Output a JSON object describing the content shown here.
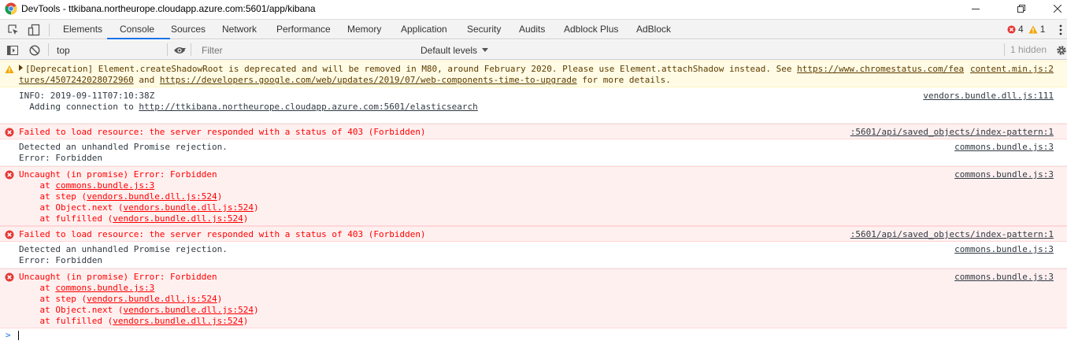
{
  "window": {
    "title": "DevTools - ttkibana.northeurope.cloudapp.azure.com:5601/app/kibana"
  },
  "tabs": [
    {
      "label": "Elements"
    },
    {
      "label": "Console"
    },
    {
      "label": "Sources"
    },
    {
      "label": "Network"
    },
    {
      "label": "Performance"
    },
    {
      "label": "Memory"
    },
    {
      "label": "Application"
    },
    {
      "label": "Security"
    },
    {
      "label": "Audits"
    },
    {
      "label": "Adblock Plus"
    },
    {
      "label": "AdBlock"
    }
  ],
  "active_tab": "Console",
  "counts": {
    "errors": "4",
    "warnings": "1"
  },
  "toolbar": {
    "context": "top",
    "filter_placeholder": "Filter",
    "levels": "Default levels",
    "hidden": "1 hidden"
  },
  "colors": {
    "accent": "#1a73e8",
    "error_bg": "#fff0f0",
    "error_text": "#ff0000",
    "warn_bg": "#fffbe5",
    "warn_text": "#5c3c00"
  },
  "messages": {
    "warn": {
      "line1_prefix": "[Deprecation] Element.createShadowRoot is deprecated and will be removed in M80, around February 2020. Please use Element.attachShadow instead. See ",
      "line1_link": "https://www.chromestatus.com/fea",
      "line2_link1": "tures/4507242028072960",
      "line2_mid": " and ",
      "line2_link2": "https://developers.google.com/web/updates/2019/07/web-components-time-to-upgrade",
      "line2_suffix": " for more details.",
      "source": "content.min.js:2"
    },
    "info": {
      "line1": "INFO: 2019-09-11T07:10:38Z",
      "line2_prefix": "  Adding connection to ",
      "line2_link": "http://ttkibana.northeurope.cloudapp.azure.com:5601/elasticsearch",
      "source": "vendors.bundle.dll.js:111"
    },
    "err1": {
      "text": "Failed to load resource: the server responded with a status of 403 (Forbidden)",
      "source": ":5601/api/saved_objects/index-pattern:1"
    },
    "rej1": {
      "line1": "Detected an unhandled Promise rejection.",
      "line2": "Error: Forbidden",
      "source": "commons.bundle.js:3"
    },
    "unc1": {
      "line1": "Uncaught (in promise) Error: Forbidden",
      "at": "    at ",
      "f1_link": "commons.bundle.js:3",
      "f2_pre": "step (",
      "f2_link": "vendors.bundle.dll.js:524",
      "f3_pre": "Object.next (",
      "f3_link": "vendors.bundle.dll.js:524",
      "f4_pre": "fulfilled (",
      "f4_link": "vendors.bundle.dll.js:524",
      "close": ")",
      "source": "commons.bundle.js:3"
    },
    "err2": {
      "text": "Failed to load resource: the server responded with a status of 403 (Forbidden)",
      "source": ":5601/api/saved_objects/index-pattern:1"
    },
    "rej2": {
      "line1": "Detected an unhandled Promise rejection.",
      "line2": "Error: Forbidden",
      "source": "commons.bundle.js:3"
    },
    "unc2": {
      "line1": "Uncaught (in promise) Error: Forbidden",
      "at": "    at ",
      "f1_link": "commons.bundle.js:3",
      "f2_pre": "step (",
      "f2_link": "vendors.bundle.dll.js:524",
      "f3_pre": "Object.next (",
      "f3_link": "vendors.bundle.dll.js:524",
      "f4_pre": "fulfilled (",
      "f4_link": "vendors.bundle.dll.js:524",
      "close": ")",
      "source": "commons.bundle.js:3"
    }
  },
  "prompt": {
    "chevron": ">"
  }
}
